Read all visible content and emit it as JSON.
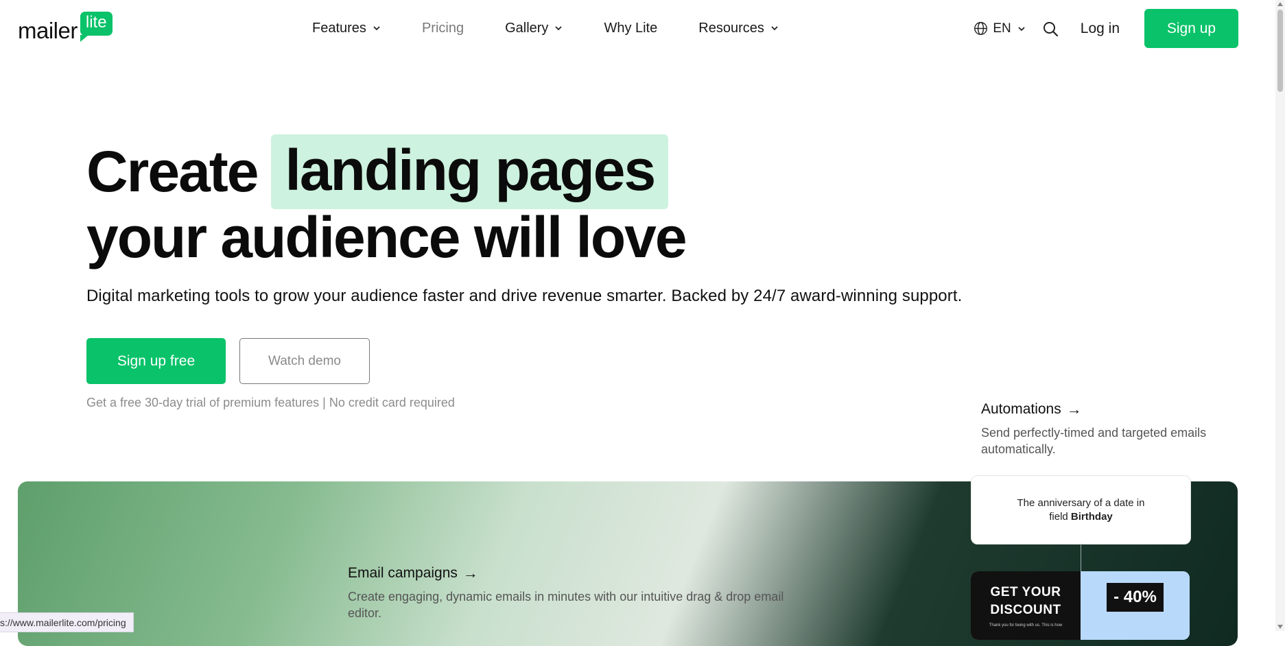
{
  "brand": {
    "logo_word": "mailer",
    "logo_badge": "lite",
    "accent_color": "#09c269",
    "highlight_color": "#cdf2df"
  },
  "nav": {
    "items": [
      {
        "label": "Features",
        "dropdown": true
      },
      {
        "label": "Pricing",
        "dropdown": false
      },
      {
        "label": "Gallery",
        "dropdown": true
      },
      {
        "label": "Why Lite",
        "dropdown": false
      },
      {
        "label": "Resources",
        "dropdown": true
      }
    ]
  },
  "header": {
    "language": "EN",
    "globe_icon": "globe-icon",
    "search_icon": "search-icon",
    "login": "Log in",
    "signup": "Sign up"
  },
  "hero": {
    "title_start": "Create",
    "title_highlight": "landing pages",
    "title_line2": "your audience will love",
    "subtitle": "Digital marketing tools to grow your audience faster and drive revenue smarter. Backed by 24/7 award-winning support.",
    "primary_cta": "Sign up free",
    "secondary_cta": "Watch demo",
    "note": "Get a free 30-day trial of premium features | No credit card required"
  },
  "features": {
    "automations": {
      "title": "Automations",
      "arrow": "→",
      "description": "Send perfectly-timed and targeted emails automatically."
    },
    "email_campaigns": {
      "title": "Email campaigns",
      "arrow": "→",
      "description": "Create engaging, dynamic emails in minutes with our intuitive drag & drop email editor."
    },
    "trigger_card": {
      "line1": "The anniversary of a date in",
      "line2_prefix": "field ",
      "line2_bold": "Birthday"
    },
    "email_preview": {
      "headline_1": "GET YOUR",
      "headline_2": "DISCOUNT",
      "small_text": "Thank you for being with us. This is how",
      "discount": "- 40%"
    }
  },
  "status_bar": {
    "url": "s://www.mailerlite.com/pricing"
  }
}
